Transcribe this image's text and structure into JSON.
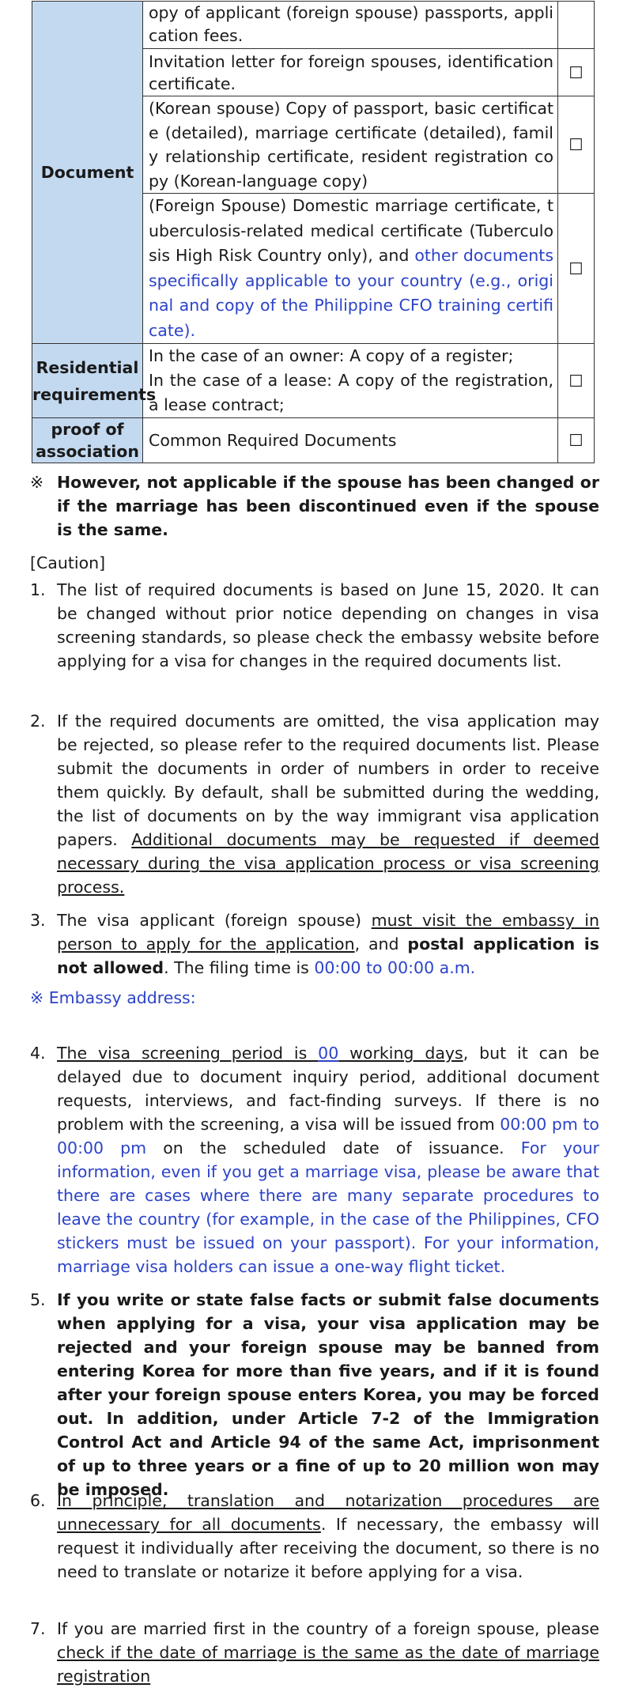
{
  "table": {
    "rows": [
      {
        "category": "",
        "parts": [
          {
            "text": "opy of applicant (foreign spouse) passports, application fees.",
            "style": ""
          }
        ],
        "checkbox": ""
      },
      {
        "category": "",
        "parts": [
          {
            "text": "Invitation letter for foreign spouses, identification certificate.",
            "style": ""
          }
        ],
        "checkbox": "☐"
      },
      {
        "category": "",
        "parts": [
          {
            "text": "(Korean spouse) Copy of passport, basic certificate (detailed), marriage certificate (detailed), family relationship certificate, resident registration copy (Korean-language copy)",
            "style": ""
          }
        ],
        "checkbox": "☐"
      },
      {
        "category": "",
        "parts": [
          {
            "text": "(Foreign Spouse) Domestic marriage certificate, tuberculosis-related medical certificate (Tuberculosis High Risk Country only), and ",
            "style": ""
          },
          {
            "text": "other documents specifically applicable to your country (e.g., original and copy of the Philippine CFO training certificate).",
            "style": "blue"
          }
        ],
        "checkbox": "☐"
      },
      {
        "category": "Residential requirements",
        "parts": [
          {
            "text": "In the case of an owner: A copy of a register;",
            "style": ""
          },
          {
            "text": "In the case of a lease: A copy of the registration, a lease contract;",
            "style": ""
          }
        ],
        "checkbox": "☐"
      },
      {
        "category": "proof of association",
        "parts": [
          {
            "text": "Common Required Documents",
            "style": ""
          }
        ],
        "checkbox": "☐"
      }
    ],
    "document_label": "Document"
  },
  "notice": {
    "mark": "※",
    "text": "However, not applicable if the spouse has been changed or if the marriage has been discontinued even if the spouse is the same."
  },
  "caution_title": "[Caution]",
  "items": [
    {
      "num": "1.",
      "parts": [
        {
          "text": "The list of required documents is based on June 15, 2020. It can be changed without prior notice depending on changes in visa screening standards, so please check the embassy website before applying for a visa for changes in the required documents list.",
          "style": ""
        }
      ]
    },
    {
      "num": "2.",
      "parts": [
        {
          "text": "If the required documents are omitted, the visa application may be rejected, so please refer to the required documents list. Please submit the documents in order of numbers in order to receive them quickly. By default, shall be submitted during the wedding, the list of documents on by the way immigrant visa application papers. ",
          "style": ""
        },
        {
          "text": "Additional documents may be requested if deemed necessary during the visa application process or visa screening process.",
          "style": "u"
        }
      ]
    },
    {
      "num": "3.",
      "parts": [
        {
          "text": "The visa applicant (foreign spouse) ",
          "style": ""
        },
        {
          "text": "must visit the embassy in person to apply for the application",
          "style": "u"
        },
        {
          "text": ", and ",
          "style": ""
        },
        {
          "text": "postal application is not allowed",
          "style": "b"
        },
        {
          "text": ". The filing time is ",
          "style": ""
        },
        {
          "text": "00:00 to 00:00 a.m.",
          "style": "blue"
        }
      ]
    },
    {
      "num": "4.",
      "parts": [
        {
          "text": "The visa screening period is ",
          "style": "u"
        },
        {
          "text": "00",
          "style": "u blue"
        },
        {
          "text": " working days",
          "style": "u"
        },
        {
          "text": ", but it can be delayed due to document inquiry period, additional document requests, interviews, and fact-finding surveys. If there is no problem with the screening, a visa will be issued from ",
          "style": ""
        },
        {
          "text": "00:00 pm to 00:00 pm",
          "style": "blue"
        },
        {
          "text": " on the scheduled date of issuance. ",
          "style": ""
        },
        {
          "text": "For your information, even if you get a marriage visa, please be aware that there are cases where there are many separate procedures to leave the country (for example, in the case of the Philippines, CFO stickers must be issued on your passport). For your information, marriage visa holders can issue a one-way flight ticket.",
          "style": "blue"
        }
      ]
    },
    {
      "num": "5.",
      "parts": [
        {
          "text": "If you write or state false facts or submit false documents when applying for a visa, your visa application may be rejected and your foreign spouse may be banned from entering Korea for more than five years, and if it is found after your foreign spouse enters Korea, you may be forced out. In addition, under Article 7-2 of the Immigration Control Act and Article 94 of the same Act, imprisonment of up to three years or a fine of up to 20 million won may be imposed.",
          "style": "b"
        }
      ]
    },
    {
      "num": "6.",
      "parts": [
        {
          "text": "In principle, translation and notarization procedures are unnecessary for all documents",
          "style": "u"
        },
        {
          "text": ". If necessary, the embassy will request it individually after receiving the document, so there is no need to translate or notarize it before applying for a visa.",
          "style": ""
        }
      ]
    },
    {
      "num": "7.",
      "parts": [
        {
          "text": "If you are married first in the country of a foreign spouse, please ",
          "style": ""
        },
        {
          "text": "check if the date of marriage is the same as the date of marriage registration",
          "style": "u"
        }
      ]
    }
  ],
  "embassy_address": "※ Embassy address:",
  "colors": {
    "category_bg": "#c3d9f0",
    "blue_text": "#2c43c8",
    "border": "#333333"
  }
}
